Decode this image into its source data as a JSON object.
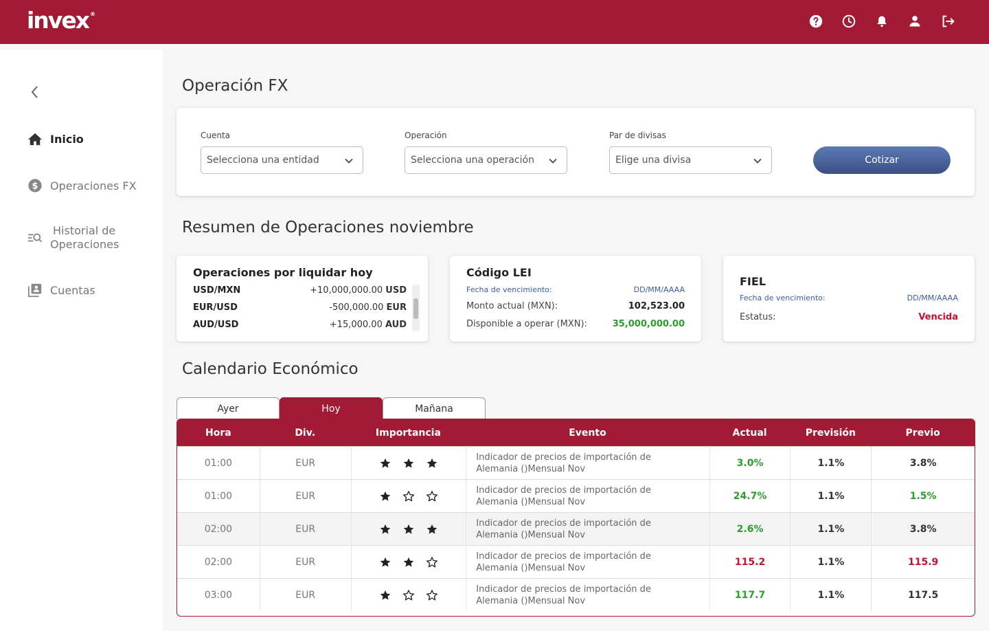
{
  "brand": {
    "name": "invex",
    "mark": "®"
  },
  "header_icons": [
    "help-icon",
    "clock-icon",
    "bell-icon",
    "user-icon",
    "logout-icon"
  ],
  "sidebar": {
    "items": [
      {
        "label": "Inicio",
        "icon": "home-icon",
        "active": true
      },
      {
        "label": "Operaciones FX",
        "icon": "dollar-icon"
      },
      {
        "label_line1": "Historial de",
        "label_line2": "Operaciones",
        "icon": "search-list-icon"
      },
      {
        "label": "Cuentas",
        "icon": "accounts-icon"
      }
    ]
  },
  "page": {
    "title": "Operación FX"
  },
  "form": {
    "cuenta": {
      "label": "Cuenta",
      "placeholder": "Selecciona una entidad"
    },
    "operacion": {
      "label": "Operación",
      "placeholder": "Selecciona una operación"
    },
    "par": {
      "label": "Par de divisas",
      "placeholder": "Elige una divisa"
    },
    "cotizar": "Cotizar"
  },
  "resumen": {
    "title": "Resumen de Operaciones noviembre",
    "liquidar": {
      "title": "Operaciones por liquidar hoy",
      "rows": [
        {
          "pair": "USD/MXN",
          "amount": "+10,000,000.00",
          "currency": "USD"
        },
        {
          "pair": "EUR/USD",
          "amount": "-500,000.00",
          "currency": "EUR"
        },
        {
          "pair": "AUD/USD",
          "amount": "+15,000.00",
          "currency": "AUD"
        }
      ]
    },
    "lei": {
      "title": "Código LEI",
      "fecha_label": "Fecha de vencimiento:",
      "fecha_value": "DD/MM/AAAA",
      "monto_label": "Monto actual (MXN):",
      "monto_value": "102,523.00",
      "disp_label": "Disponible a operar (MXN):",
      "disp_value": "35,000,000.00"
    },
    "fiel": {
      "title": "FIEL",
      "fecha_label": "Fecha de vencimiento:",
      "fecha_value": "DD/MM/AAAA",
      "estatus_label": "Estatus:",
      "estatus_value": "Vencida"
    }
  },
  "calendario": {
    "title": "Calendario Económico",
    "tabs": [
      "Ayer",
      "Hoy",
      "Mañana"
    ],
    "active_tab": "Hoy",
    "columns": [
      "Hora",
      "Div.",
      "Importancia",
      "Evento",
      "Actual",
      "Previsión",
      "Previo"
    ],
    "rows": [
      {
        "hora": "01:00",
        "div": "EUR",
        "stars": 3,
        "evento1": "Indicador de precios de importación de",
        "evento2": "Alemania ()Mensual Nov",
        "actual": "3.0%",
        "actual_color": "green",
        "prevision": "1.1%",
        "previo": "3.8%",
        "previo_color": "normal"
      },
      {
        "hora": "01:00",
        "div": "EUR",
        "stars": 1,
        "evento1": "Indicador de precios de importación de",
        "evento2": "Alemania ()Mensual Nov",
        "actual": "24.7%",
        "actual_color": "green",
        "prevision": "1.1%",
        "previo": "1.5%",
        "previo_color": "green"
      },
      {
        "hora": "02:00",
        "div": "EUR",
        "stars": 3,
        "evento1": "Indicador de precios de importación de",
        "evento2": "Alemania ()Mensual Nov",
        "actual": "2.6%",
        "actual_color": "green",
        "prevision": "1.1%",
        "previo": "3.8%",
        "previo_color": "normal"
      },
      {
        "hora": "02:00",
        "div": "EUR",
        "stars": 2,
        "evento1": "Indicador de precios de importación de",
        "evento2": "Alemania ()Mensual Nov",
        "actual": "115.2",
        "actual_color": "red",
        "prevision": "1.1%",
        "previo": "115.9",
        "previo_color": "red"
      },
      {
        "hora": "03:00",
        "div": "EUR",
        "stars": 1,
        "evento1": "Indicador de precios de importación de",
        "evento2": "Alemania ()Mensual Nov",
        "actual": "117.7",
        "actual_color": "green",
        "prevision": "1.1%",
        "previo": "117.5",
        "previo_color": "normal"
      }
    ]
  },
  "colors": {
    "brand": "#a31a35",
    "button": "#4a64a0",
    "positive": "#2a9d2a",
    "negative": "#c8102e"
  }
}
